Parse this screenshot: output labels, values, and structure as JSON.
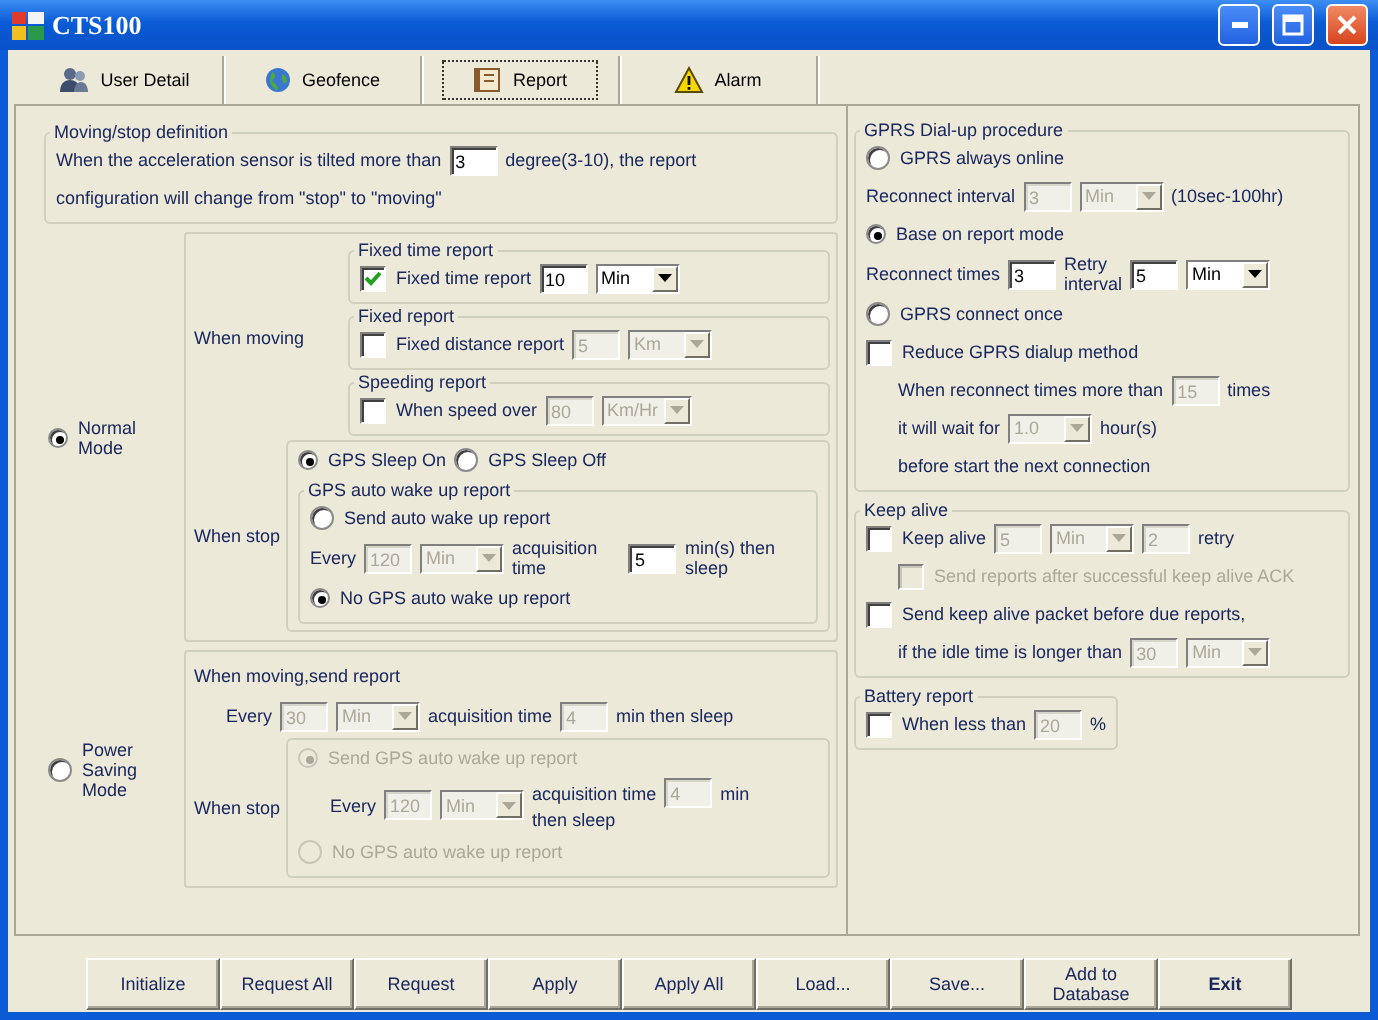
{
  "window": {
    "title": "CTS100"
  },
  "tabs": [
    {
      "label": "User Detail",
      "selected": false
    },
    {
      "label": "Geofence",
      "selected": false
    },
    {
      "label": "Report",
      "selected": true
    },
    {
      "label": "Alarm",
      "selected": false
    }
  ],
  "motion": {
    "legend": "Moving/stop definition",
    "blocks": [
      {
        "kind": "row",
        "items": [
          {
            "kind": "text",
            "text": "When the acceleration sensor is tilted more than"
          },
          {
            "kind": "input",
            "value": "3",
            "disabled": false
          },
          {
            "kind": "text",
            "text": "degree(3-10),  the report"
          }
        ]
      },
      {
        "kind": "row",
        "items": [
          {
            "kind": "text",
            "text": "configuration will change from \"stop\" to \"moving\""
          }
        ]
      }
    ]
  },
  "modes": [
    {
      "label": "Normal Mode",
      "selected": true,
      "blocks": [
        {
          "kind": "split",
          "label": "When moving",
          "blocks": [
            {
              "kind": "group",
              "legend": "Fixed time report",
              "blocks": [
                {
                  "kind": "row",
                  "items": [
                    {
                      "kind": "check",
                      "label": "Fixed time report",
                      "checked": true,
                      "disabled": false
                    },
                    {
                      "kind": "input",
                      "value": "10",
                      "disabled": false
                    },
                    {
                      "kind": "select",
                      "value": "Min",
                      "disabled": false
                    }
                  ]
                }
              ]
            },
            {
              "kind": "group",
              "legend": "Fixed report",
              "blocks": [
                {
                  "kind": "row",
                  "items": [
                    {
                      "kind": "check",
                      "label": "Fixed distance report",
                      "checked": false,
                      "disabled": false
                    },
                    {
                      "kind": "input",
                      "value": "5",
                      "disabled": true
                    },
                    {
                      "kind": "select",
                      "value": "Km",
                      "disabled": true
                    }
                  ]
                }
              ]
            },
            {
              "kind": "group",
              "legend": "Speeding report",
              "blocks": [
                {
                  "kind": "row",
                  "items": [
                    {
                      "kind": "check",
                      "label": "When speed over",
                      "checked": false,
                      "disabled": false
                    },
                    {
                      "kind": "input",
                      "value": "80",
                      "disabled": true
                    },
                    {
                      "kind": "select",
                      "value": "Km/Hr",
                      "disabled": true
                    }
                  ]
                }
              ]
            }
          ]
        },
        {
          "kind": "split",
          "label": "When stop",
          "blocks": [
            {
              "kind": "group",
              "blocks": [
                {
                  "kind": "row",
                  "items": [
                    {
                      "kind": "radio",
                      "label": "GPS Sleep On",
                      "selected": true,
                      "disabled": false
                    },
                    {
                      "kind": "radio",
                      "label": "GPS Sleep Off",
                      "selected": false,
                      "disabled": false
                    }
                  ]
                },
                {
                  "kind": "group",
                  "legend": "GPS auto wake up report",
                  "blocks": [
                    {
                      "kind": "row",
                      "items": [
                        {
                          "kind": "radio",
                          "label": "Send auto wake up report",
                          "selected": false,
                          "disabled": false
                        }
                      ]
                    },
                    {
                      "kind": "row",
                      "items": [
                        {
                          "kind": "text",
                          "text": "Every"
                        },
                        {
                          "kind": "input",
                          "value": "120",
                          "disabled": true
                        },
                        {
                          "kind": "select",
                          "value": "Min",
                          "disabled": true
                        },
                        {
                          "kind": "text",
                          "text": "acquisition time"
                        },
                        {
                          "kind": "input",
                          "value": "5",
                          "disabled": false
                        },
                        {
                          "kind": "text",
                          "text": "min(s) then sleep"
                        }
                      ]
                    },
                    {
                      "kind": "row",
                      "items": [
                        {
                          "kind": "radio",
                          "label": "No GPS auto wake up report",
                          "selected": true,
                          "disabled": false
                        }
                      ]
                    }
                  ]
                }
              ]
            }
          ]
        }
      ]
    },
    {
      "label": "Power\nSaving Mode",
      "selected": false,
      "blocks": [
        {
          "kind": "row",
          "items": [
            {
              "kind": "text",
              "text": "When moving,send report"
            }
          ]
        },
        {
          "kind": "indented",
          "items": [
            {
              "kind": "text",
              "text": "Every"
            },
            {
              "kind": "input",
              "value": "30",
              "disabled": true
            },
            {
              "kind": "select",
              "value": "Min",
              "disabled": true
            },
            {
              "kind": "text",
              "text": "acquisition time"
            },
            {
              "kind": "input",
              "value": "4",
              "disabled": true
            },
            {
              "kind": "text",
              "text": "min then sleep"
            }
          ]
        },
        {
          "kind": "split",
          "label": "When stop",
          "blocks": [
            {
              "kind": "group",
              "blocks": [
                {
                  "kind": "row",
                  "items": [
                    {
                      "kind": "radio",
                      "label": "Send GPS auto wake up report",
                      "selected": true,
                      "disabled": true
                    }
                  ]
                },
                {
                  "kind": "indented",
                  "items": [
                    {
                      "kind": "text",
                      "text": "Every"
                    },
                    {
                      "kind": "input",
                      "value": "120",
                      "disabled": true
                    },
                    {
                      "kind": "select",
                      "value": "Min",
                      "disabled": true
                    },
                    {
                      "kind": "stack",
                      "rows": [
                        [
                          {
                            "kind": "text",
                            "text": "acquisition time"
                          },
                          {
                            "kind": "input",
                            "value": "4",
                            "disabled": true
                          },
                          {
                            "kind": "text",
                            "text": "min"
                          }
                        ],
                        [
                          {
                            "kind": "text",
                            "text": "then sleep"
                          }
                        ]
                      ]
                    }
                  ]
                },
                {
                  "kind": "row",
                  "items": [
                    {
                      "kind": "radio",
                      "label": "No GPS auto wake up report",
                      "selected": false,
                      "disabled": true
                    }
                  ]
                }
              ]
            }
          ]
        }
      ]
    }
  ],
  "gprs": {
    "legend": "GPRS Dial-up procedure",
    "blocks": [
      {
        "kind": "row",
        "items": [
          {
            "kind": "radio",
            "label": "GPRS always online",
            "selected": false,
            "disabled": false
          }
        ]
      },
      {
        "kind": "row",
        "items": [
          {
            "kind": "text",
            "text": "Reconnect interval"
          },
          {
            "kind": "input",
            "value": "3",
            "disabled": true
          },
          {
            "kind": "select",
            "value": "Min",
            "disabled": true
          },
          {
            "kind": "text",
            "text": "(10sec-100hr)"
          }
        ]
      },
      {
        "kind": "row",
        "items": [
          {
            "kind": "radio",
            "label": "Base on report mode",
            "selected": true,
            "disabled": false
          }
        ]
      },
      {
        "kind": "row",
        "items": [
          {
            "kind": "text",
            "text": "Reconnect times"
          },
          {
            "kind": "input",
            "value": "3",
            "disabled": false
          },
          {
            "kind": "text",
            "text": "Retry\ninterval"
          },
          {
            "kind": "input",
            "value": "5",
            "disabled": false
          },
          {
            "kind": "select",
            "value": "Min",
            "disabled": false
          }
        ]
      },
      {
        "kind": "row",
        "items": [
          {
            "kind": "radio",
            "label": "GPRS connect once",
            "selected": false,
            "disabled": false
          }
        ]
      },
      {
        "kind": "row",
        "items": [
          {
            "kind": "check",
            "label": "Reduce GPRS dialup method",
            "checked": false,
            "disabled": false
          }
        ]
      },
      {
        "kind": "indented",
        "items": [
          {
            "kind": "text",
            "text": "When reconnect times more than"
          },
          {
            "kind": "input",
            "value": "15",
            "disabled": true
          },
          {
            "kind": "text",
            "text": "times"
          }
        ]
      },
      {
        "kind": "indented",
        "items": [
          {
            "kind": "text",
            "text": "it will wait for"
          },
          {
            "kind": "select",
            "value": "1.0",
            "disabled": true
          },
          {
            "kind": "text",
            "text": "hour(s)"
          }
        ]
      },
      {
        "kind": "indented",
        "items": [
          {
            "kind": "text",
            "text": "before start the next connection"
          }
        ]
      }
    ]
  },
  "keep_alive": {
    "legend": "Keep alive",
    "blocks": [
      {
        "kind": "row",
        "items": [
          {
            "kind": "check",
            "label": "Keep alive",
            "checked": false,
            "disabled": false
          },
          {
            "kind": "input",
            "value": "5",
            "disabled": true
          },
          {
            "kind": "select",
            "value": "Min",
            "disabled": true
          },
          {
            "kind": "input",
            "value": "2",
            "disabled": true
          },
          {
            "kind": "text",
            "text": "retry"
          }
        ]
      },
      {
        "kind": "indented",
        "items": [
          {
            "kind": "check",
            "label": "Send reports after successful keep alive ACK",
            "checked": false,
            "disabled": true
          }
        ]
      },
      {
        "kind": "row",
        "items": [
          {
            "kind": "check",
            "label": "Send keep alive packet before due reports,",
            "checked": false,
            "disabled": false
          }
        ]
      },
      {
        "kind": "indented",
        "items": [
          {
            "kind": "text",
            "text": "if the idle time is longer than"
          },
          {
            "kind": "input",
            "value": "30",
            "disabled": true
          },
          {
            "kind": "select",
            "value": "Min",
            "disabled": true
          }
        ]
      }
    ]
  },
  "battery": {
    "legend": "Battery report",
    "blocks": [
      {
        "kind": "row",
        "items": [
          {
            "kind": "check",
            "label": "When less than",
            "checked": false,
            "disabled": false
          },
          {
            "kind": "input",
            "value": "20",
            "disabled": true
          },
          {
            "kind": "text",
            "text": "%"
          }
        ]
      }
    ]
  },
  "buttons": [
    {
      "label": "Initialize",
      "default": false
    },
    {
      "label": "Request All",
      "default": false
    },
    {
      "label": "Request",
      "default": false
    },
    {
      "label": "Apply",
      "default": false
    },
    {
      "label": "Apply All",
      "default": false
    },
    {
      "label": "Load...",
      "default": false
    },
    {
      "label": "Save...",
      "default": false
    },
    {
      "label": "Add to Database",
      "default": false
    },
    {
      "label": "Exit",
      "default": true
    }
  ]
}
